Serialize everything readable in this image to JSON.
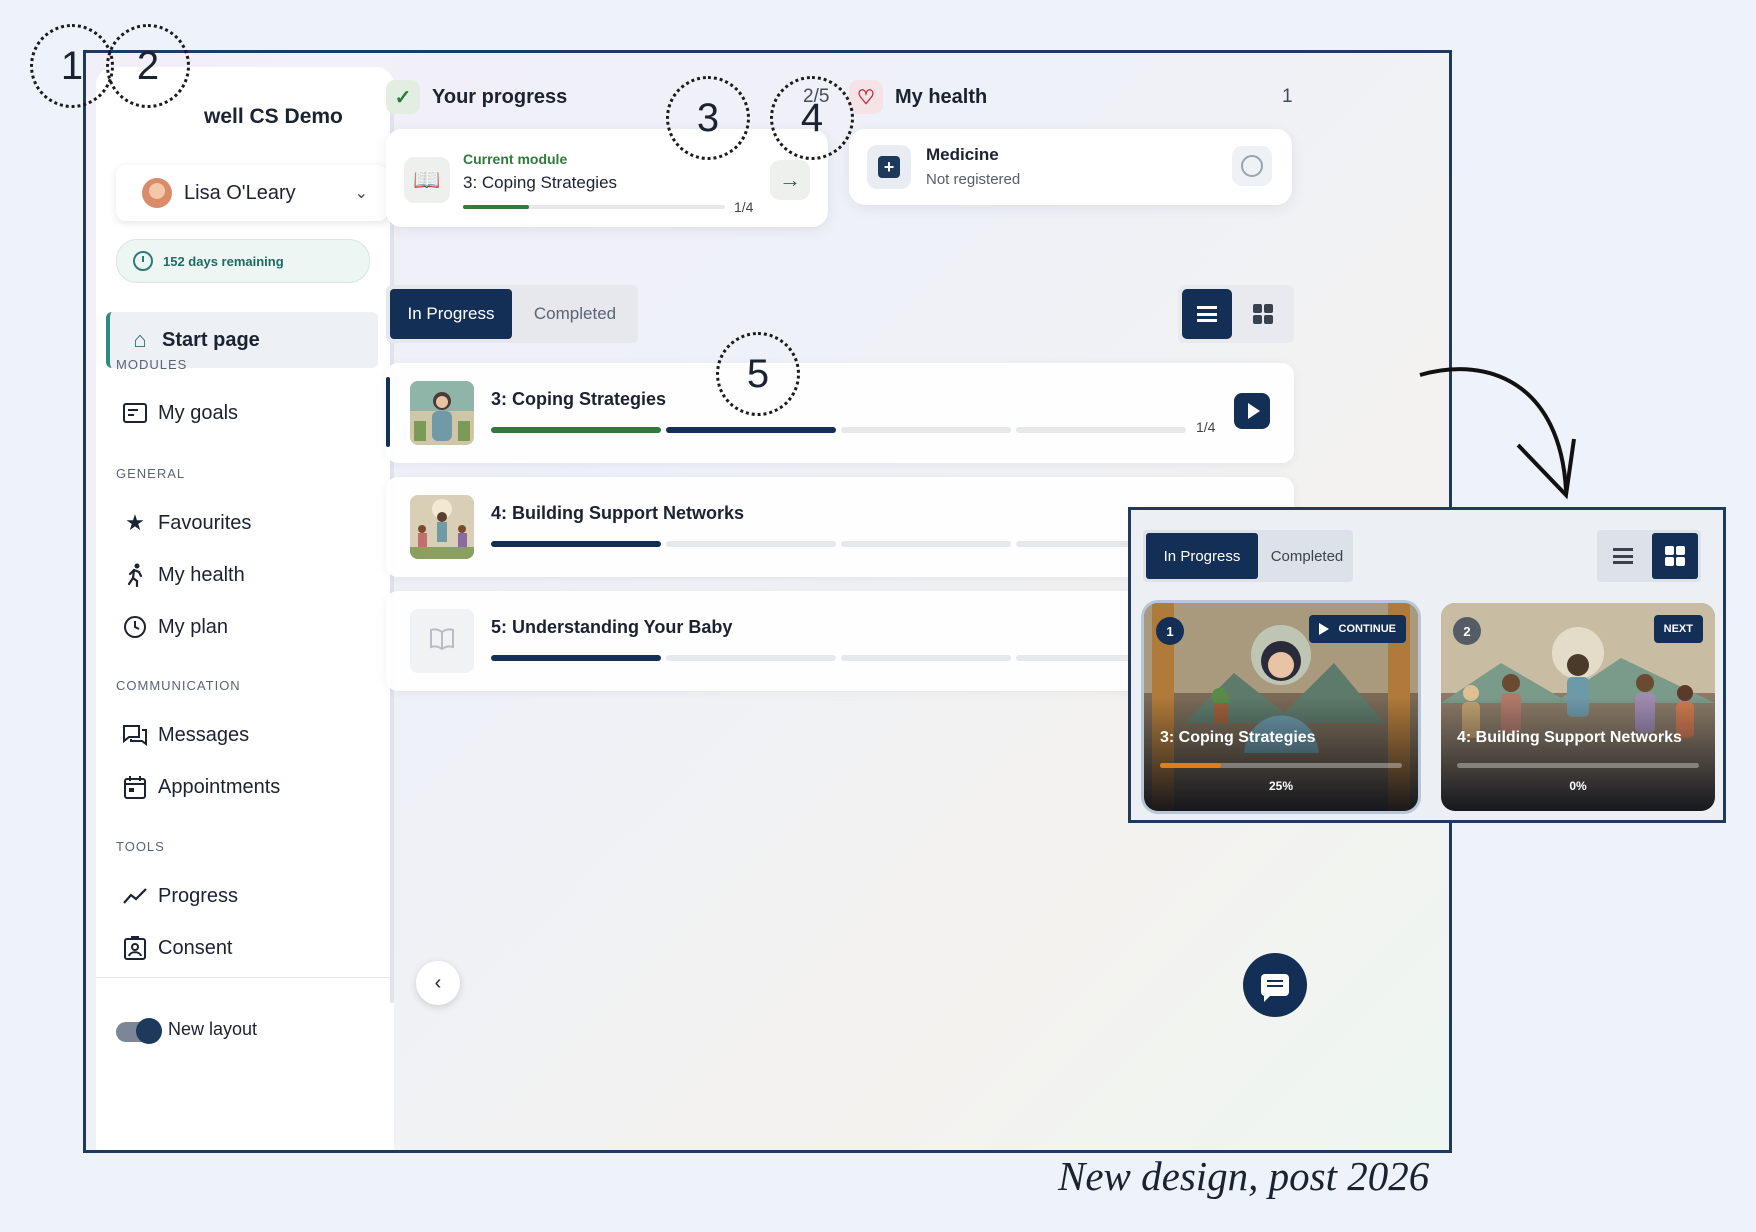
{
  "sidebar": {
    "brand": "well CS Demo",
    "user": "Lisa O'Leary",
    "days_remaining": "152 days remaining",
    "active_item": "Start page",
    "sections": [
      {
        "heading": "MODULES",
        "items": [
          {
            "label": "My goals",
            "icon": "goals-icon"
          }
        ]
      },
      {
        "heading": "GENERAL",
        "items": [
          {
            "label": "Favourites",
            "icon": "star-icon"
          },
          {
            "label": "My health",
            "icon": "running-icon"
          },
          {
            "label": "My plan",
            "icon": "clock-icon"
          }
        ]
      },
      {
        "heading": "COMMUNICATION",
        "items": [
          {
            "label": "Messages",
            "icon": "messages-icon"
          },
          {
            "label": "Appointments",
            "icon": "calendar-icon"
          }
        ]
      },
      {
        "heading": "TOOLS",
        "items": [
          {
            "label": "Progress",
            "icon": "trend-icon"
          },
          {
            "label": "Consent",
            "icon": "consent-icon"
          }
        ]
      }
    ],
    "toggle_label": "New layout"
  },
  "progress": {
    "title": "Your progress",
    "count": "2/5",
    "current_label": "Current module",
    "current_module": "3: Coping Strategies",
    "fraction": "1/4",
    "fill": 0.25
  },
  "health": {
    "title": "My health",
    "count": "1",
    "medicine_title": "Medicine",
    "medicine_status": "Not registered"
  },
  "tabs": {
    "in_progress": "In Progress",
    "completed": "Completed"
  },
  "modules": [
    {
      "title": "3: Coping Strategies",
      "fraction": "1/4",
      "segments": [
        "done",
        "current",
        "empty",
        "empty"
      ]
    },
    {
      "title": "4: Building Support Networks",
      "segments": [
        "current",
        "empty",
        "empty",
        "empty"
      ]
    },
    {
      "title": "5: Understanding Your Baby",
      "segments": [
        "current",
        "empty",
        "empty",
        "empty"
      ]
    }
  ],
  "annotations": [
    "1",
    "2",
    "3",
    "4",
    "5"
  ],
  "inset": {
    "tab_in_progress": "In Progress",
    "tab_completed": "Completed",
    "tiles": [
      {
        "num": "1",
        "pill": "CONTINUE",
        "title": "3: Coping Strategies",
        "pct": "25%",
        "fill": 0.25
      },
      {
        "num": "2",
        "pill": "NEXT",
        "title": "4: Building Support Networks",
        "pct": "0%",
        "fill": 0
      }
    ]
  },
  "caption": "New design, post 2026",
  "colors": {
    "navy": "#132f55",
    "green": "#2f7a3c",
    "orange": "#e07d1c",
    "frame": "#1f3a5f"
  }
}
